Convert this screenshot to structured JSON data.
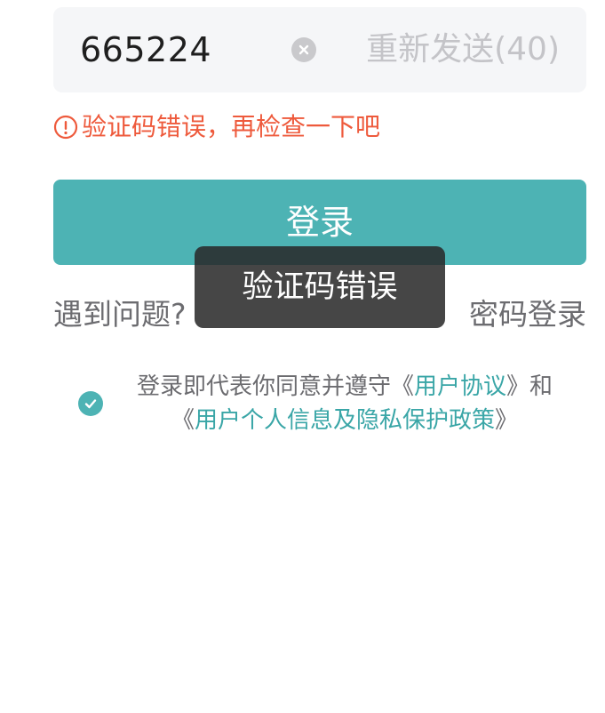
{
  "code_input": {
    "value": "665224",
    "resend_label": "重新发送(40)"
  },
  "error": {
    "message": "验证码错误，再检查一下吧"
  },
  "login": {
    "button_label": "登录"
  },
  "links": {
    "help": "遇到问题?",
    "password_login": "密码登录"
  },
  "toast": {
    "message": "验证码错误"
  },
  "agreement": {
    "prefix": "登录即代表你同意并遵守《",
    "user_agreement": "用户协议",
    "middle": "》和",
    "open_bracket": "《",
    "privacy_policy": "用户个人信息及隐私保护政策",
    "close_bracket": "》"
  },
  "colors": {
    "accent": "#4db3b4",
    "error": "#ee5a3c",
    "link": "#3aa6a7"
  }
}
